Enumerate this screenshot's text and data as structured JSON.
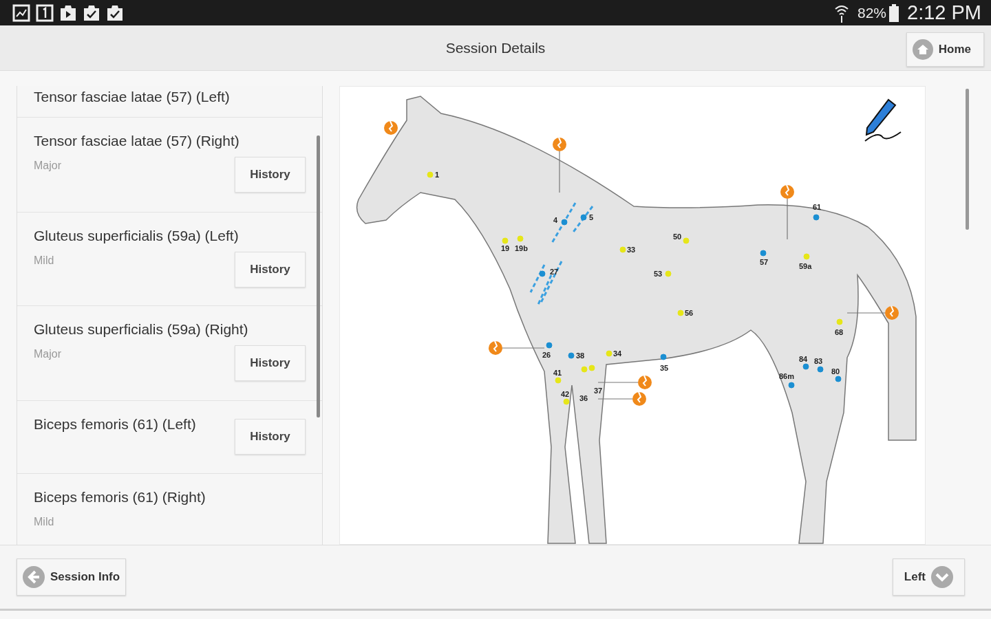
{
  "status_bar": {
    "battery": "82%",
    "time": "2:12 PM"
  },
  "header": {
    "title": "Session Details",
    "home_button": "Home"
  },
  "muscles": [
    {
      "name": "Tensor fasciae latae (57) (Left)"
    },
    {
      "name": "Tensor fasciae latae (57) (Right)",
      "severity": "Major",
      "history_button": "History"
    },
    {
      "name": "Gluteus superficialis (59a) (Left)",
      "severity": "Mild",
      "history_button": "History"
    },
    {
      "name": "Gluteus superficialis (59a) (Right)",
      "severity": "Major",
      "history_button": "History"
    },
    {
      "name": "Biceps femoris (61) (Left)",
      "history_button": "History"
    },
    {
      "name": "Biceps femoris (61) (Right)",
      "severity": "Mild"
    }
  ],
  "diagram": {
    "points": [
      {
        "label": "1",
        "color": "#e6e619"
      },
      {
        "label": "19",
        "color": "#e6e619"
      },
      {
        "label": "19b",
        "color": "#e6e619"
      },
      {
        "label": "4",
        "color": "#1b8fd2"
      },
      {
        "label": "5",
        "color": "#1b8fd2"
      },
      {
        "label": "27",
        "color": "#1b8fd2"
      },
      {
        "label": "33",
        "color": "#e6e619"
      },
      {
        "label": "53",
        "color": "#e6e619"
      },
      {
        "label": "50",
        "color": "#e6e619"
      },
      {
        "label": "56",
        "color": "#e6e619"
      },
      {
        "label": "57",
        "color": "#1b8fd2"
      },
      {
        "label": "59a",
        "color": "#e6e619"
      },
      {
        "label": "61",
        "color": "#1b8fd2"
      },
      {
        "label": "68",
        "color": "#e6e619"
      },
      {
        "label": "26",
        "color": "#1b8fd2"
      },
      {
        "label": "38",
        "color": "#1b8fd2"
      },
      {
        "label": "34",
        "color": "#e6e619"
      },
      {
        "label": "35",
        "color": "#1b8fd2"
      },
      {
        "label": "41",
        "color": "#e6e619"
      },
      {
        "label": "42",
        "color": "#e6e619"
      },
      {
        "label": "37",
        "color": "#e6e619"
      },
      {
        "label": "36",
        "color": "#e6e619"
      },
      {
        "label": "84",
        "color": "#1b8fd2"
      },
      {
        "label": "83",
        "color": "#1b8fd2"
      },
      {
        "label": "80",
        "color": "#1b8fd2"
      },
      {
        "label": "86m",
        "color": "#1b8fd2"
      }
    ]
  },
  "footer": {
    "back_button": "Session Info",
    "side_button": "Left"
  }
}
